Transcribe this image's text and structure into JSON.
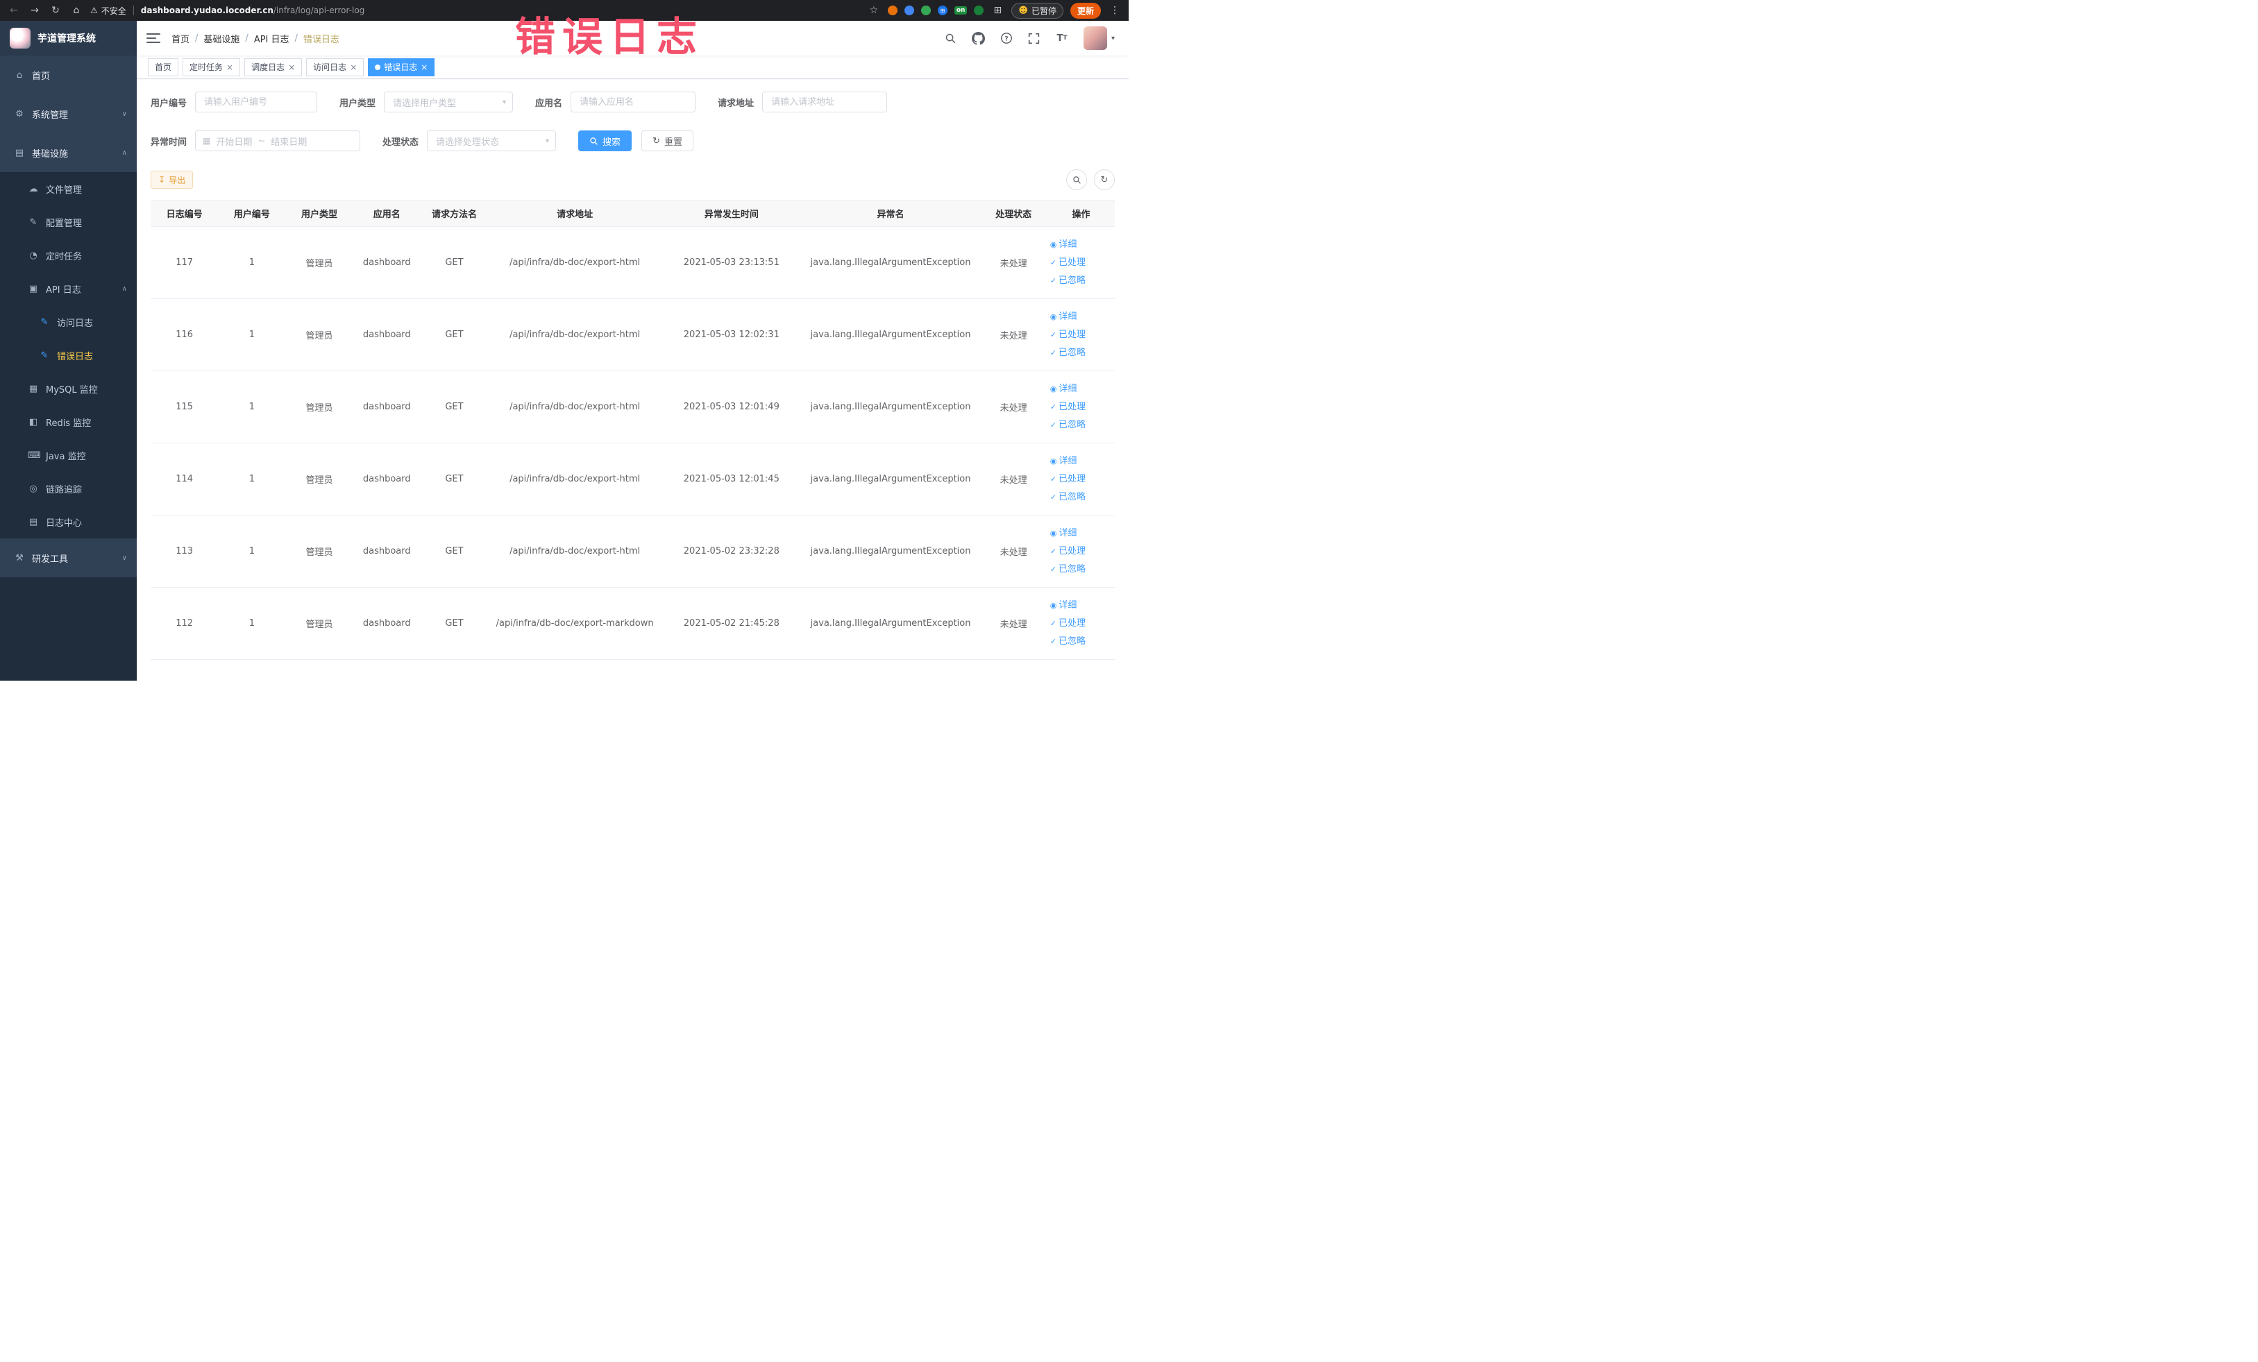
{
  "annotation": {
    "text": "错误日志"
  },
  "browser": {
    "security_text": "不安全",
    "url_domain": "dashboard.yudao.iocoder.cn",
    "url_path": "/infra/log/api-error-log",
    "ext_on_badge": "on",
    "paused_text": "已暂停",
    "update_button": "更新"
  },
  "icons": {
    "back": "←",
    "forward": "→",
    "reload": "↻",
    "home_nav": "⌂",
    "warning": "⚠",
    "star": "☆",
    "menu_dots": "⋮",
    "smiley": "☻",
    "grid": "⊞",
    "home": "⌂",
    "system": "⚙",
    "infra": "▤",
    "file": "☁",
    "config": "✎",
    "job": "◔",
    "api": "▣",
    "log": "✎",
    "mysql": "▦",
    "redis": "◧",
    "java": "⌨",
    "trace": "◎",
    "logcenter": "▤",
    "tools": "⚒",
    "chevron_up": "∧",
    "chevron_down": "∨",
    "calendar": "▦",
    "download": "↧",
    "refresh": "↻",
    "eye": "◉",
    "check": "✓",
    "caret": "▾"
  },
  "sidebar": {
    "app_title": "芋道管理系统",
    "items": [
      {
        "key": "home",
        "label": "首页",
        "icon": "home",
        "level": 1,
        "sub": false
      },
      {
        "key": "system-mgmt",
        "label": "系统管理",
        "icon": "system",
        "level": 1,
        "sub": false,
        "chevron": "down"
      },
      {
        "key": "infra",
        "label": "基础设施",
        "icon": "infra",
        "level": 1,
        "sub": false,
        "chevron": "up"
      },
      {
        "key": "file-mgmt",
        "label": "文件管理",
        "icon": "file",
        "level": 2,
        "sub": true
      },
      {
        "key": "config-mgmt",
        "label": "配置管理",
        "icon": "config",
        "level": 2,
        "sub": true
      },
      {
        "key": "job",
        "label": "定时任务",
        "icon": "job",
        "level": 2,
        "sub": true
      },
      {
        "key": "api-log",
        "label": "API 日志",
        "icon": "api",
        "level": 2,
        "sub": true,
        "chevron": "up"
      },
      {
        "key": "access-log",
        "label": "访问日志",
        "icon": "log",
        "level": 3,
        "sub": true,
        "icon_color": "#409eff"
      },
      {
        "key": "error-log",
        "label": "错误日志",
        "icon": "log",
        "level": 3,
        "sub": true,
        "icon_color": "#409eff",
        "active": true
      },
      {
        "key": "mysql",
        "label": "MySQL 监控",
        "icon": "mysql",
        "level": 2,
        "sub": true
      },
      {
        "key": "redis",
        "label": "Redis 监控",
        "icon": "redis",
        "level": 2,
        "sub": true
      },
      {
        "key": "java",
        "label": "Java 监控",
        "icon": "java",
        "level": 2,
        "sub": true
      },
      {
        "key": "trace",
        "label": "链路追踪",
        "icon": "trace",
        "level": 2,
        "sub": true
      },
      {
        "key": "log-center",
        "label": "日志中心",
        "icon": "logcenter",
        "level": 2,
        "sub": true
      },
      {
        "key": "dev-tools",
        "label": "研发工具",
        "icon": "tools",
        "level": 1,
        "sub": false,
        "chevron": "down"
      }
    ]
  },
  "header": {
    "breadcrumb": [
      "首页",
      "基础设施",
      "API 日志",
      "错误日志"
    ],
    "breadcrumb_sep": "/"
  },
  "tabs": [
    {
      "key": "home",
      "label": "首页",
      "closable": false,
      "active": false
    },
    {
      "key": "job",
      "label": "定时任务",
      "closable": true,
      "active": false
    },
    {
      "key": "job-log",
      "label": "调度日志",
      "closable": true,
      "active": false
    },
    {
      "key": "access-log",
      "label": "访问日志",
      "closable": true,
      "active": false
    },
    {
      "key": "error-log",
      "label": "错误日志",
      "closable": true,
      "active": true
    }
  ],
  "filters": {
    "user_id": {
      "label": "用户编号",
      "placeholder": "请输入用户编号"
    },
    "user_type": {
      "label": "用户类型",
      "placeholder": "请选择用户类型"
    },
    "app_name": {
      "label": "应用名",
      "placeholder": "请输入应用名"
    },
    "request_url": {
      "label": "请求地址",
      "placeholder": "请输入请求地址"
    },
    "exception_time": {
      "label": "异常时间",
      "start_placeholder": "开始日期",
      "separator": "~",
      "end_placeholder": "结束日期"
    },
    "process_status": {
      "label": "处理状态",
      "placeholder": "请选择处理状态"
    },
    "search_button": "搜索",
    "reset_button": "重置"
  },
  "toolbar": {
    "export_button": "导出"
  },
  "table": {
    "headers": [
      "日志编号",
      "用户编号",
      "用户类型",
      "应用名",
      "请求方法名",
      "请求地址",
      "异常发生时间",
      "异常名",
      "处理状态",
      "操作"
    ],
    "actions": {
      "detail": "详细",
      "processed": "已处理",
      "ignored": "已忽略"
    },
    "rows": [
      {
        "log_id": "117",
        "user_id": "1",
        "user_type": "管理员",
        "app_name": "dashboard",
        "method": "GET",
        "url": "/api/infra/db-doc/export-html",
        "time": "2021-05-03 23:13:51",
        "exception": "java.lang.IllegalArgumentException",
        "status": "未处理"
      },
      {
        "log_id": "116",
        "user_id": "1",
        "user_type": "管理员",
        "app_name": "dashboard",
        "method": "GET",
        "url": "/api/infra/db-doc/export-html",
        "time": "2021-05-03 12:02:31",
        "exception": "java.lang.IllegalArgumentException",
        "status": "未处理"
      },
      {
        "log_id": "115",
        "user_id": "1",
        "user_type": "管理员",
        "app_name": "dashboard",
        "method": "GET",
        "url": "/api/infra/db-doc/export-html",
        "time": "2021-05-03 12:01:49",
        "exception": "java.lang.IllegalArgumentException",
        "status": "未处理"
      },
      {
        "log_id": "114",
        "user_id": "1",
        "user_type": "管理员",
        "app_name": "dashboard",
        "method": "GET",
        "url": "/api/infra/db-doc/export-html",
        "time": "2021-05-03 12:01:45",
        "exception": "java.lang.IllegalArgumentException",
        "status": "未处理"
      },
      {
        "log_id": "113",
        "user_id": "1",
        "user_type": "管理员",
        "app_name": "dashboard",
        "method": "GET",
        "url": "/api/infra/db-doc/export-html",
        "time": "2021-05-02 23:32:28",
        "exception": "java.lang.IllegalArgumentException",
        "status": "未处理"
      },
      {
        "log_id": "112",
        "user_id": "1",
        "user_type": "管理员",
        "app_name": "dashboard",
        "method": "GET",
        "url": "/api/infra/db-doc/export-markdown",
        "time": "2021-05-02 21:45:28",
        "exception": "java.lang.IllegalArgumentException",
        "status": "未处理"
      }
    ]
  },
  "colors": {
    "primary": "#409eff",
    "sidebar_bg": "#304156",
    "submenu_bg": "#1f2d3d",
    "active_menu_text": "#ffd04b",
    "warning": "#e6a23c",
    "annotation": "#f4516c",
    "update_button": "#e8590c"
  }
}
